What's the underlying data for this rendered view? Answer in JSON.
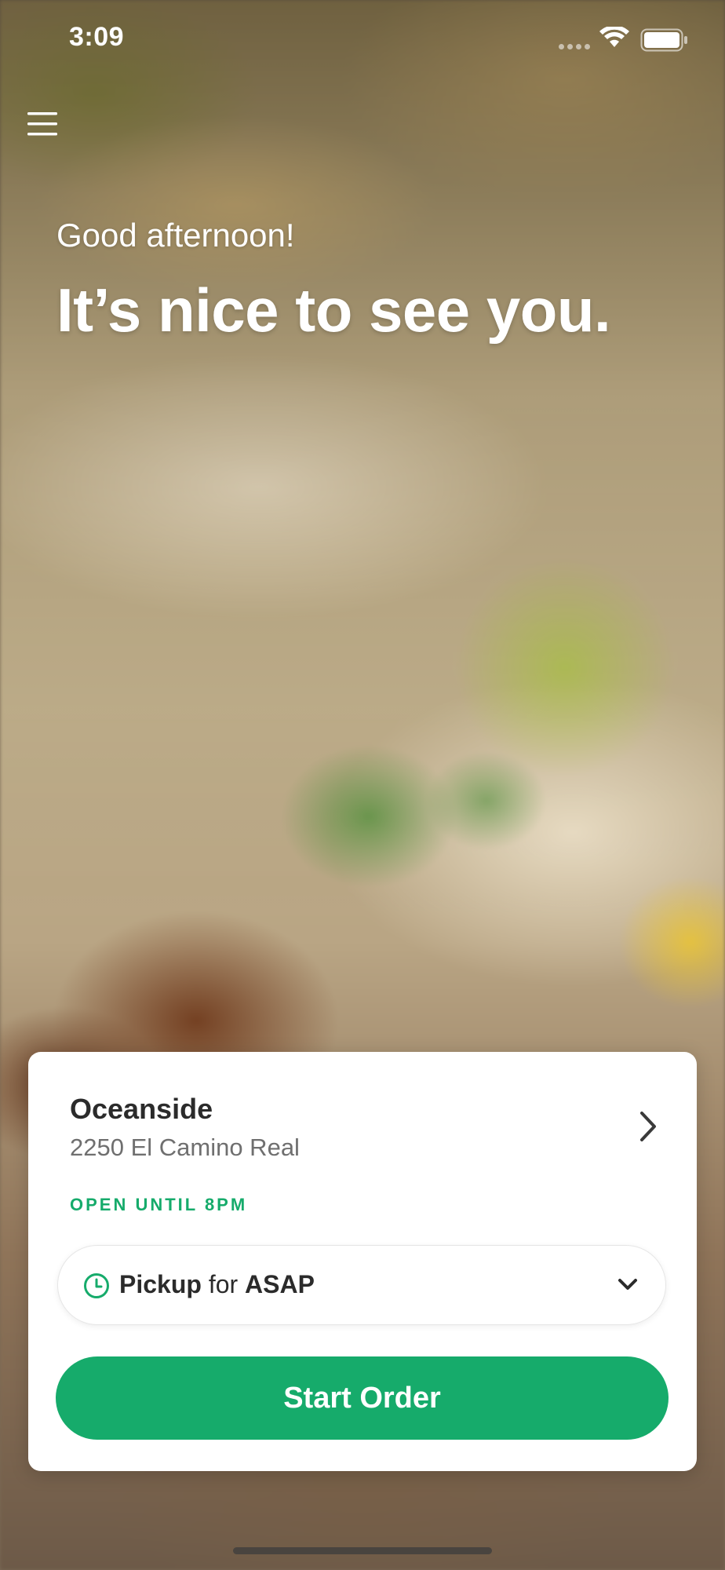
{
  "status_bar": {
    "time": "3:09",
    "icons": [
      "cellular-signal-icon",
      "wifi-icon",
      "battery-icon"
    ]
  },
  "header": {
    "menu_icon": "hamburger-menu-icon",
    "greeting": "Good afternoon!",
    "headline": "It’s nice to see you."
  },
  "background": {
    "description_icon": "food-photo-background"
  },
  "order_card": {
    "store_name": "Oceanside",
    "store_address": "2250 El Camino Real",
    "store_hours": "OPEN UNTIL 8PM",
    "pickup": {
      "mode": "Pickup",
      "connector": "for",
      "time": "ASAP"
    },
    "start_order_label": "Start Order"
  },
  "colors": {
    "accent": "#16ab6b",
    "card": "#ffffff",
    "text_dark": "#2b2b2b",
    "text_muted": "#6f6f6f"
  }
}
